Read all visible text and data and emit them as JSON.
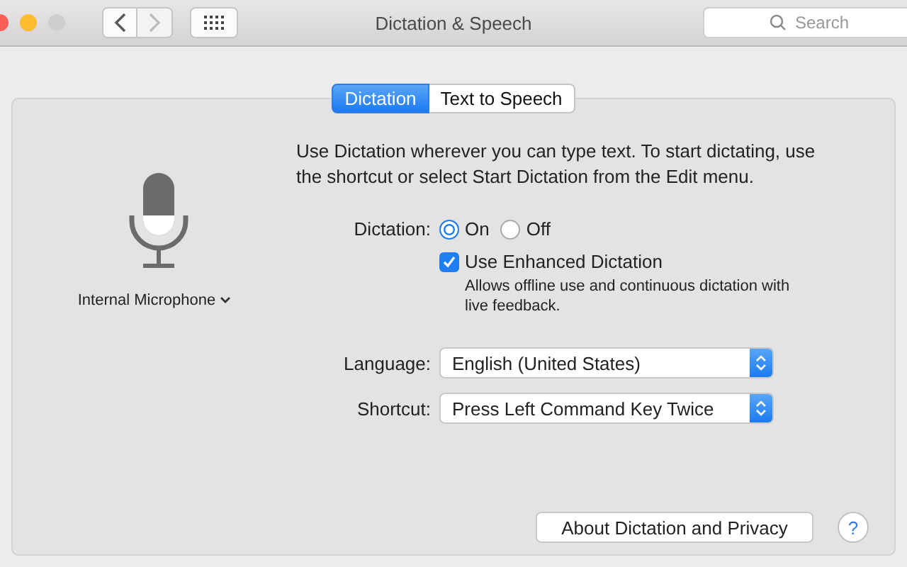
{
  "window": {
    "title": "Dictation & Speech",
    "lights": [
      {
        "kind": "close"
      },
      {
        "kind": "minimize"
      },
      {
        "kind": "zoom"
      }
    ],
    "nav": [
      {
        "kind": "back",
        "disabled": false
      },
      {
        "kind": "forward",
        "disabled": true
      }
    ],
    "search": {
      "placeholder": "Search"
    }
  },
  "tabs": [
    {
      "label": "Dictation",
      "selected": true
    },
    {
      "label": "Text to Speech",
      "selected": false
    }
  ],
  "microphone": {
    "label": "Internal Microphone"
  },
  "intro": "Use Dictation wherever you can type text. To start dictating, use the shortcut or select Start Dictation from the Edit menu.",
  "dictation": {
    "label": "Dictation:",
    "options": [
      {
        "label": "On",
        "selected": true
      },
      {
        "label": "Off",
        "selected": false
      }
    ]
  },
  "enhanced": {
    "label": "Use Enhanced Dictation",
    "checked": true,
    "note": "Allows offline use and continuous dictation with live feedback."
  },
  "popups": [
    {
      "label": "Language:",
      "value": "English (United States)"
    },
    {
      "label": "Shortcut:",
      "value": "Press Left Command Key Twice"
    }
  ],
  "about_button": "About Dictation and Privacy",
  "help": "?"
}
